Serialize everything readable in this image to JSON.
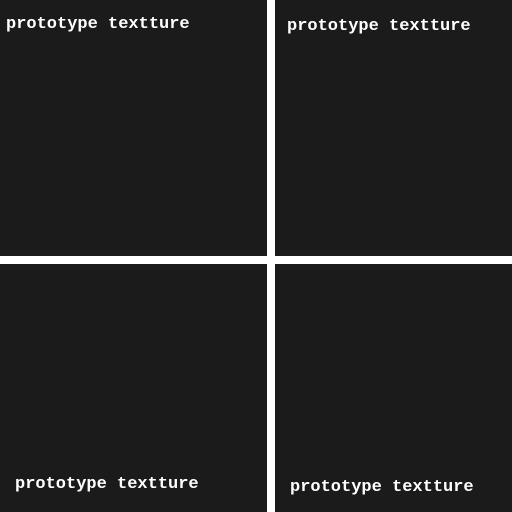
{
  "tiles": [
    {
      "label": "prototype textture"
    },
    {
      "label": "prototype textture"
    },
    {
      "label": "prototype textture"
    },
    {
      "label": "prototype textture"
    }
  ],
  "colors": {
    "tile_background": "#1b1b1b",
    "separator": "#ffffff",
    "label_text": "#ffffff"
  }
}
